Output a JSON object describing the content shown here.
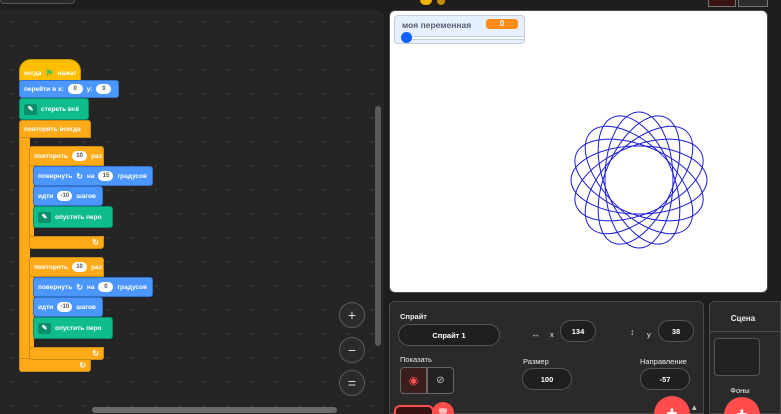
{
  "code": {
    "when_flag": "когда",
    "when_flag_suffix": "нажат",
    "goto_label": "перейти в х:",
    "goto_x": "0",
    "goto_y_label": "у:",
    "goto_y": "0",
    "erase_all": "стереть всё",
    "forever": "повторять всегда",
    "repeat1_label": "повторить",
    "repeat1_count": "10",
    "repeat1_suffix": "раз",
    "turn1_label": "повернуть",
    "turn1_on": "на",
    "turn1_value": "15",
    "turn1_suffix": "градусов",
    "move1_label": "идти",
    "move1_value": "-10",
    "move1_suffix": "шагов",
    "pen_down1": "опустить перо",
    "repeat2_label": "повторить",
    "repeat2_count": "10",
    "repeat2_suffix": "раз",
    "turn2_label": "повернуть",
    "turn2_on": "на",
    "turn2_value": "0",
    "turn2_suffix": "градусов",
    "move2_label": "идти",
    "move2_value": "-10",
    "move2_suffix": "шагов",
    "pen_down2": "опустить перо"
  },
  "zoom": {
    "in": "+",
    "out": "−",
    "reset": "="
  },
  "stage": {
    "variable_name": "моя переменная",
    "variable_value": "0",
    "variable_slider_fraction": 0.0,
    "pen_color": "#1a1ad6"
  },
  "sprite_info": {
    "sprite_label": "Спрайт",
    "sprite_name": "Спрайт 1",
    "x_label": "x",
    "x_value": "134",
    "y_label": "у",
    "y_value": "38",
    "show_label": "Показать",
    "size_label": "Размер",
    "size_value": "100",
    "direction_label": "Направление",
    "direction_value": "-57"
  },
  "stage_panel": {
    "title": "Сцена",
    "backdrops_label": "Фоны"
  },
  "colors": {
    "events": "#ffbf00",
    "motion": "#4c97ff",
    "pen": "#0fbd8c",
    "control": "#ffab19",
    "accent_red": "#ff4c4c"
  }
}
